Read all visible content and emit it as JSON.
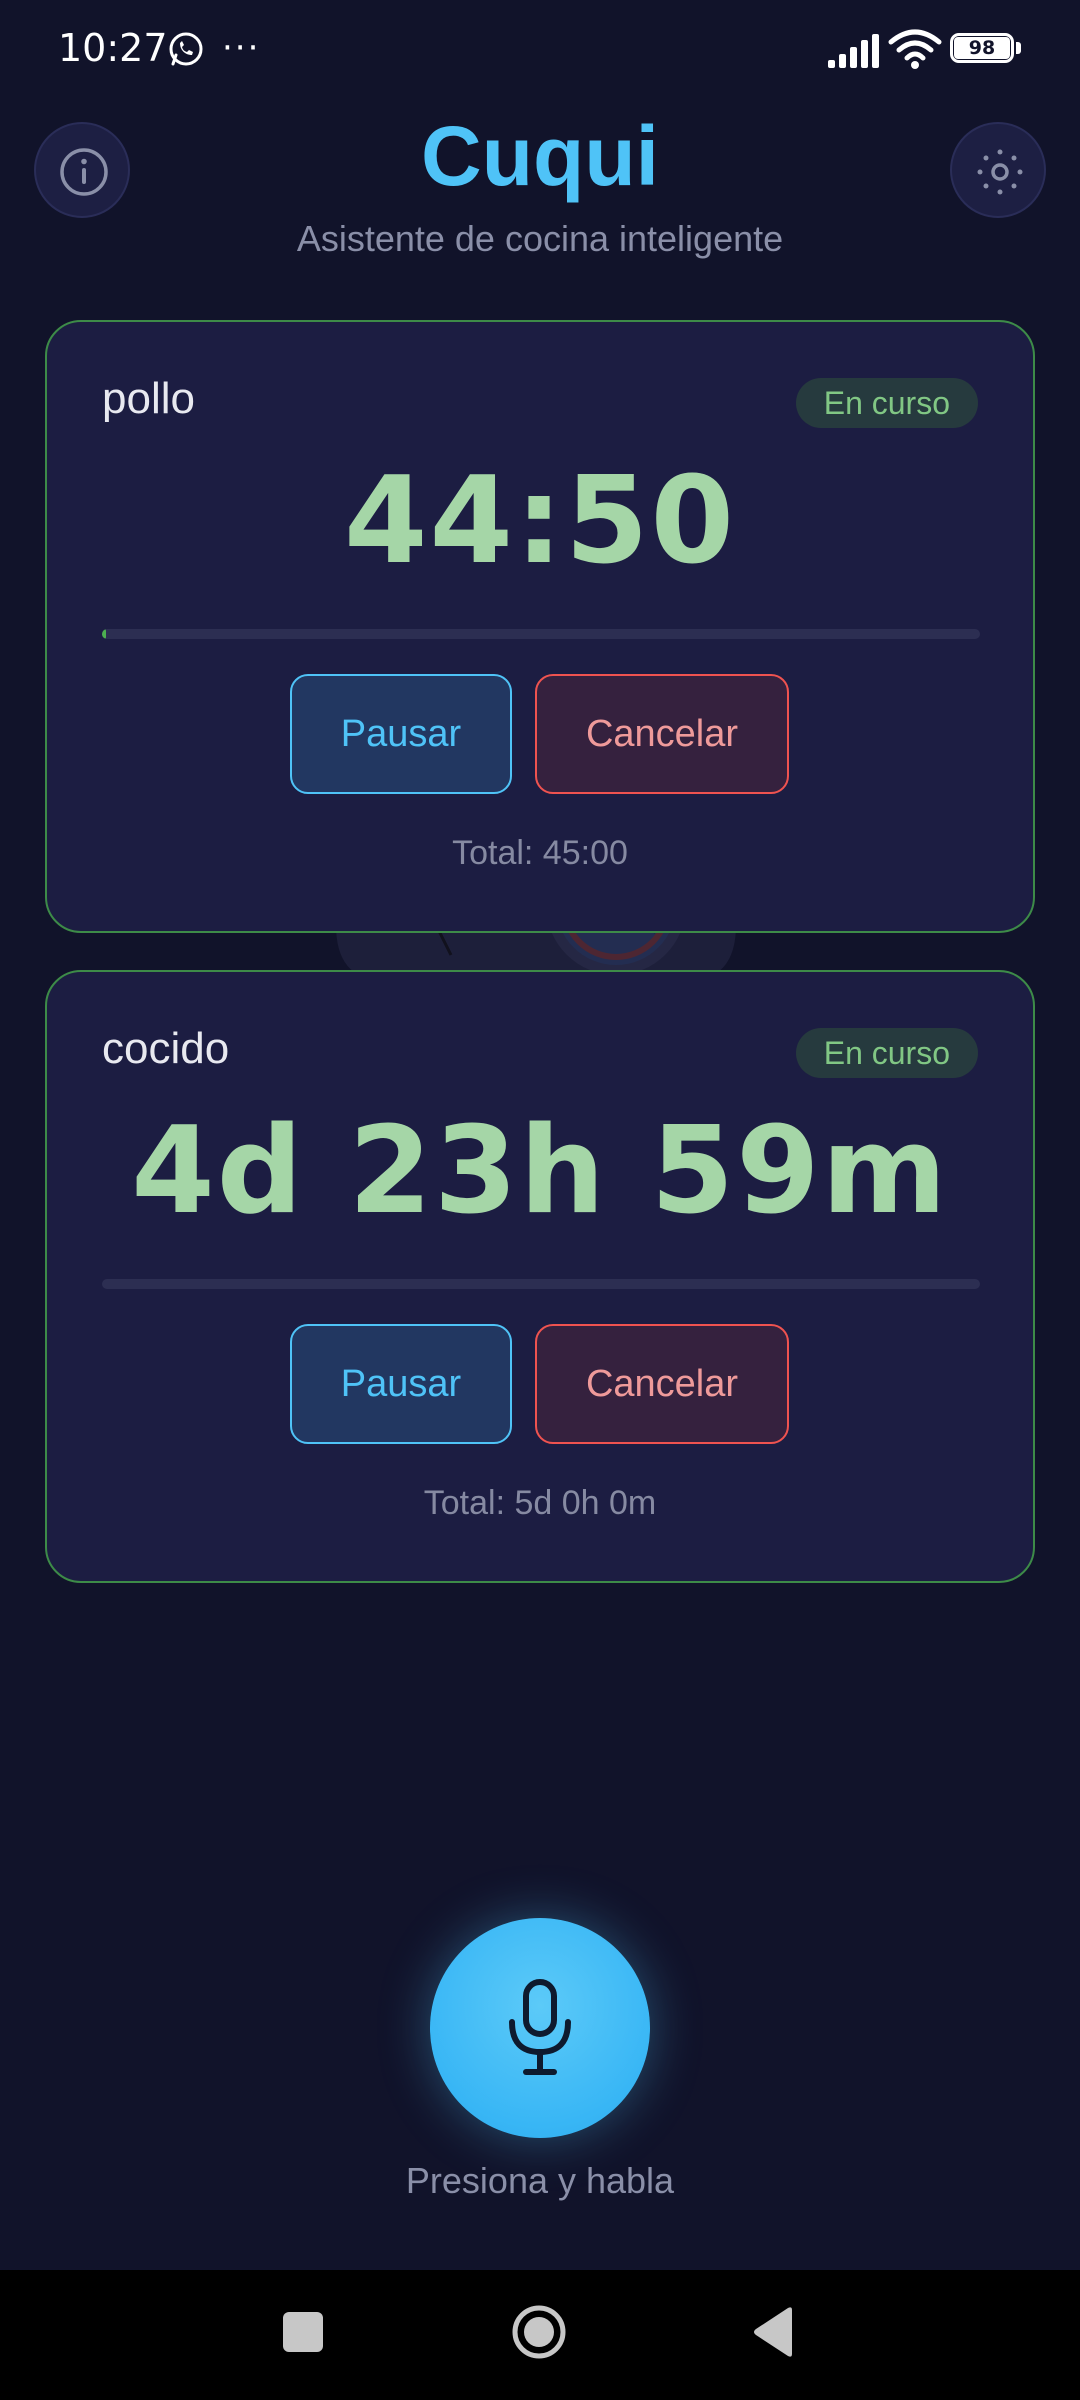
{
  "status_bar": {
    "time": "10:27",
    "more": "···",
    "battery_level": "98",
    "icons": [
      "whatsapp-icon",
      "more-icon",
      "signal-icon",
      "wifi-icon",
      "battery-icon"
    ]
  },
  "header": {
    "title": "Cuqui",
    "subtitle": "Asistente de cocina inteligente",
    "info_icon": "info-icon",
    "settings_icon": "settings-icon"
  },
  "timers": [
    {
      "name": "pollo",
      "status": "En curso",
      "remaining": "44:50",
      "progress": 0.004,
      "pause_label": "Pausar",
      "cancel_label": "Cancelar",
      "total": "Total: 45:00"
    },
    {
      "name": "cocido",
      "status": "En curso",
      "remaining": "4d 23h 59m",
      "progress": 0.0,
      "pause_label": "Pausar",
      "cancel_label": "Cancelar",
      "total": "Total: 5d 0h 0m"
    }
  ],
  "mic": {
    "icon": "microphone-icon",
    "label": "Presiona y habla"
  },
  "colors": {
    "background": "#11132a",
    "accent": "#4fc3f7",
    "card_border": "#3d8b48",
    "timer_text": "#a5d6a7",
    "cancel": "#ef5350"
  }
}
